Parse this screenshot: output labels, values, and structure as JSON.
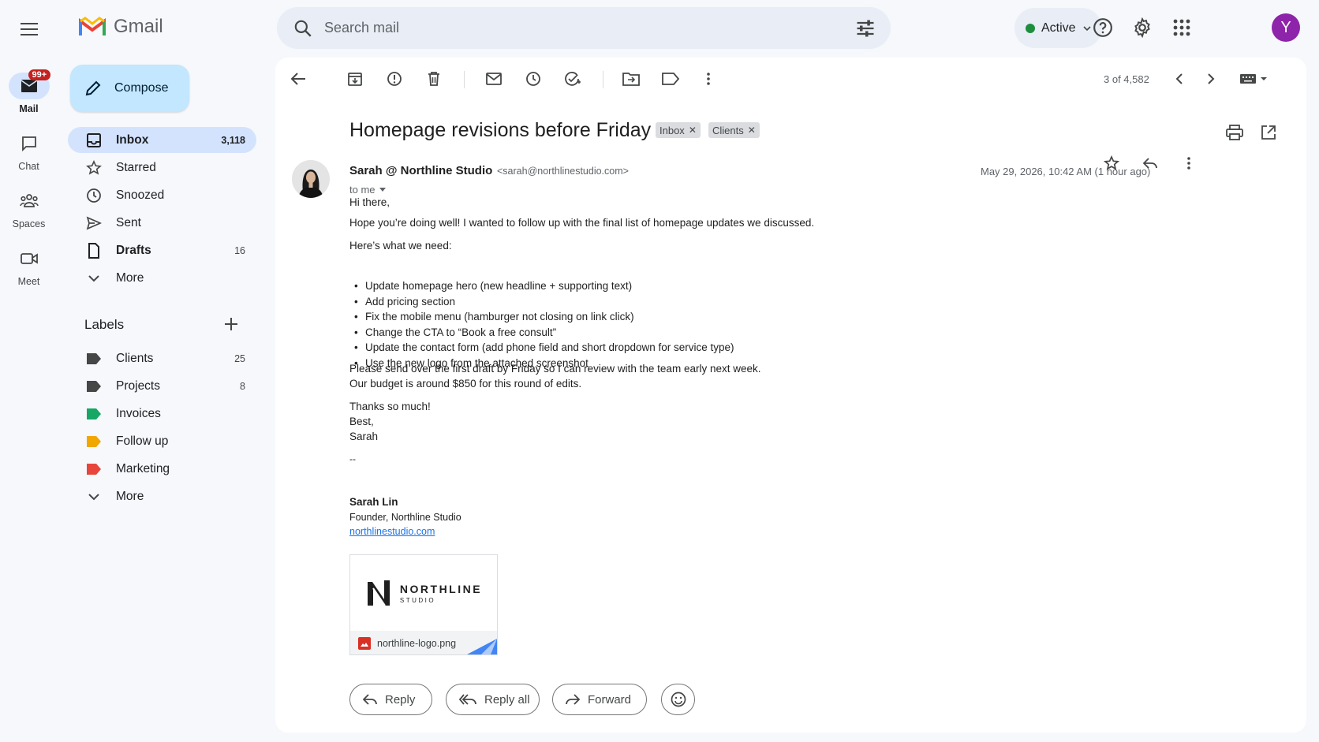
{
  "app": {
    "name": "Gmail"
  },
  "search": {
    "placeholder": "Search mail"
  },
  "status": {
    "label": "Active",
    "color": "#1e8e3e"
  },
  "account": {
    "initial": "Y",
    "color": "#8e24aa"
  },
  "rail": {
    "mail": {
      "label": "Mail",
      "badge": "99+"
    },
    "chat": {
      "label": "Chat"
    },
    "spaces": {
      "label": "Spaces"
    },
    "meet": {
      "label": "Meet"
    }
  },
  "compose": {
    "label": "Compose"
  },
  "nav": [
    {
      "label": "Inbox",
      "count": "3,118"
    },
    {
      "label": "Starred",
      "count": ""
    },
    {
      "label": "Snoozed",
      "count": ""
    },
    {
      "label": "Sent",
      "count": ""
    },
    {
      "label": "Drafts",
      "count": "16"
    },
    {
      "label": "More",
      "count": ""
    }
  ],
  "labels": {
    "heading": "Labels",
    "items": [
      {
        "label": "Clients",
        "count": "25",
        "color": "#444746"
      },
      {
        "label": "Projects",
        "count": "8",
        "color": "#444746"
      },
      {
        "label": "Invoices",
        "count": "",
        "color": "#16a765"
      },
      {
        "label": "Follow up",
        "count": "",
        "color": "#f2a600"
      },
      {
        "label": "Marketing",
        "count": "",
        "color": "#e8453c"
      }
    ],
    "more": "More"
  },
  "toolbar": {
    "pager": "3 of 4,582"
  },
  "email": {
    "subject": "Homepage revisions before Friday",
    "chips": [
      "Inbox",
      "Clients"
    ],
    "sender_name": "Sarah @ Northline Studio",
    "sender_email": "<sarah@northlinestudio.com>",
    "to": "to me",
    "date": "May 29, 2026, 10:42 AM (1 hour ago)",
    "greeting": "Hi there,",
    "intro": "Hope you’re doing well! I wanted to follow up with the final list of homepage updates we discussed.",
    "lead": "Here’s what we need:",
    "bullets": [
      "Update homepage hero (new headline + supporting text)",
      "Add pricing section",
      "Fix the mobile menu (hamburger not closing on link click)",
      "Change the CTA to “Book a free consult”",
      "Update the contact form (add phone field and short dropdown for service type)",
      "Use the new logo from the attached screenshot"
    ],
    "request_line1": "Please send over the first draft by Friday so I can review with the team early next week.",
    "request_line2": "Our budget is around $850 for this round of edits.",
    "thanks": "Thanks so much!",
    "closing": "Best,",
    "signoff": "Sarah",
    "sig_dash": "--",
    "sig_name": "Sarah Lin",
    "sig_title": "Founder, Northline Studio",
    "sig_link": "northlinestudio.com"
  },
  "attachment": {
    "filename": "northline-logo.png",
    "brand": "NORTHLINE",
    "brand_sub": "STUDIO"
  },
  "actions": {
    "reply": "Reply",
    "reply_all": "Reply all",
    "forward": "Forward"
  }
}
